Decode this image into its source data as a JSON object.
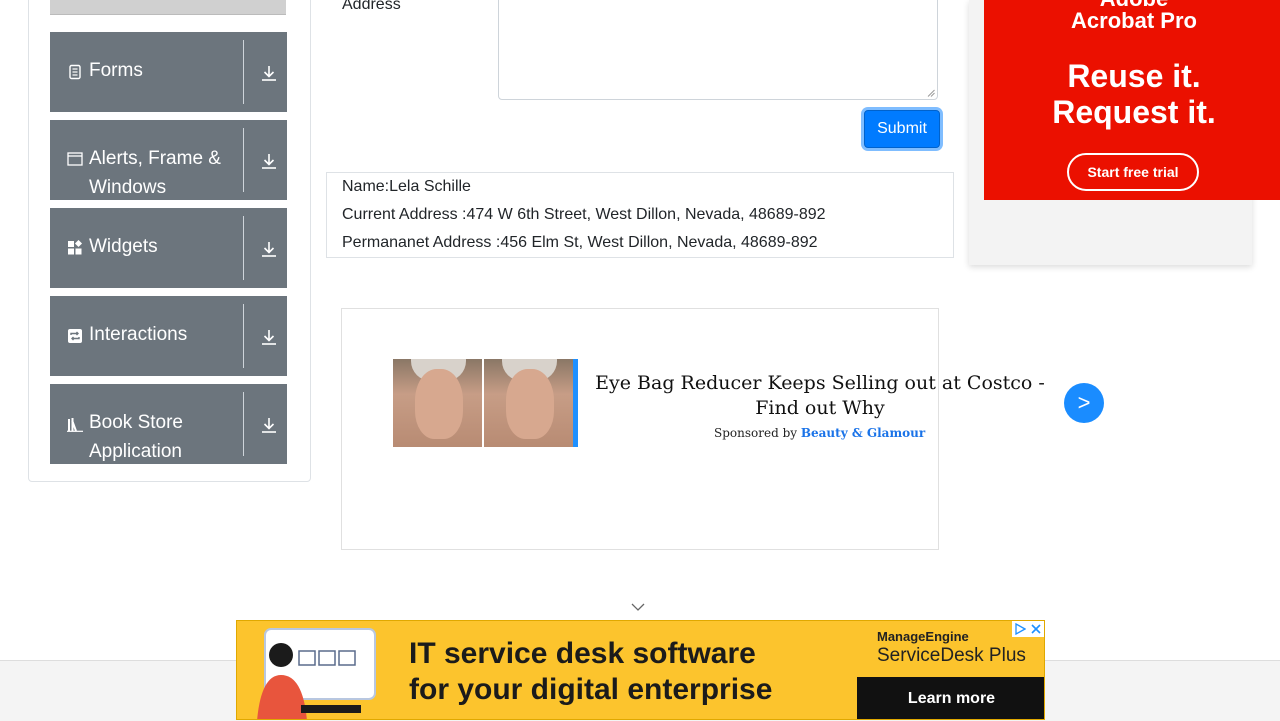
{
  "sidebar": {
    "groups": [
      {
        "label": "Forms",
        "icon": "form-icon"
      },
      {
        "label": "Alerts, Frame & Windows",
        "icon": "window-icon"
      },
      {
        "label": "Widgets",
        "icon": "widgets-icon"
      },
      {
        "label": "Interactions",
        "icon": "interactions-icon"
      },
      {
        "label": "Book Store Application",
        "icon": "books-icon"
      }
    ]
  },
  "form": {
    "address_label": "Address",
    "submit_label": "Submit"
  },
  "output": {
    "name": "Name:Lela Schille",
    "current_address": "Current Address :474 W 6th Street, West Dillon, Nevada, 48689-892",
    "permanent_address": "Permananet Address :456 Elm St, West Dillon, Nevada, 48689-892"
  },
  "mid_ad": {
    "headline": "Eye Bag Reducer Keeps Selling out at Costco - Find out Why",
    "sponsored_prefix": "Sponsored by",
    "sponsor": "Beauty & Glamour",
    "next": ">"
  },
  "right_ad": {
    "brand_line1": "Adobe",
    "brand_line2": "Acrobat Pro",
    "tagline1": "Reuse it.",
    "tagline2": "Request it.",
    "cta": "Start free trial",
    "bg_color": "#eb1000"
  },
  "bottom_ad": {
    "line1": "IT service desk software",
    "line2": "for your digital enterprise",
    "logo_line1": "ManageEngine",
    "logo_line2": "ServiceDesk Plus",
    "cta": "Learn more",
    "bg_color": "#fcc42d"
  },
  "colors": {
    "sidebar_group": "#6c757d",
    "primary": "#007bff"
  }
}
